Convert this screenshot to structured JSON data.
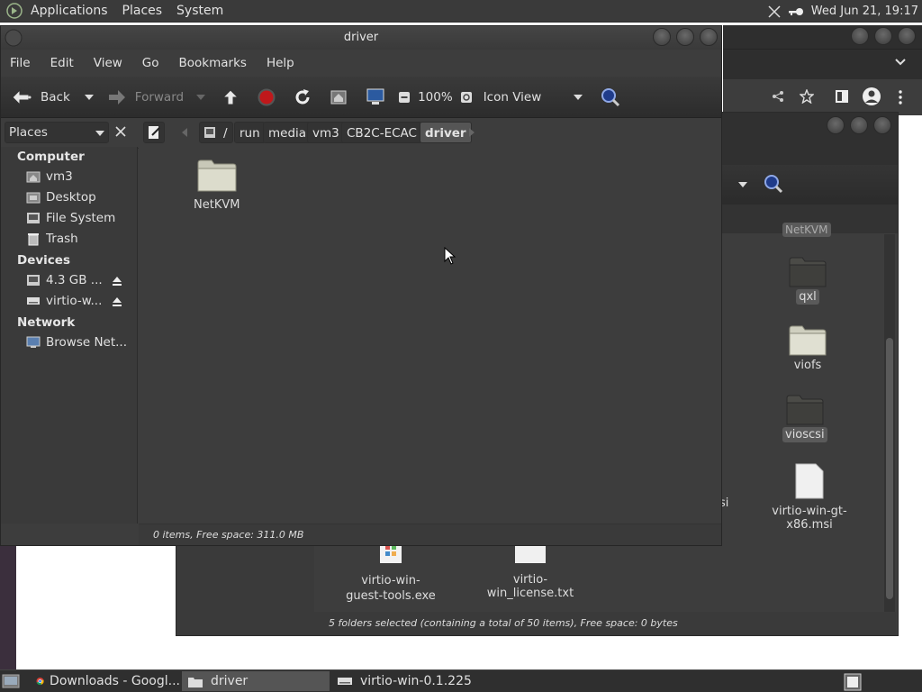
{
  "top_panel": {
    "menus": [
      "Applications",
      "Places",
      "System"
    ],
    "clock": "Wed Jun 21, 19:17"
  },
  "front_window": {
    "title": "driver",
    "menubar": [
      "File",
      "Edit",
      "View",
      "Go",
      "Bookmarks",
      "Help"
    ],
    "toolbar": {
      "back": "Back",
      "forward": "Forward",
      "zoom": "100%",
      "view_mode": "Icon View"
    },
    "sidebar_selector": "Places",
    "breadcrumbs": [
      "/",
      "run",
      "media",
      "vm3",
      "CB2C-ECAC",
      "driver"
    ],
    "sidebar": {
      "computer_heading": "Computer",
      "computer_items": [
        "vm3",
        "Desktop",
        "File System",
        "Trash"
      ],
      "devices_heading": "Devices",
      "device_items": [
        "4.3 GB ...",
        "virtio-w..."
      ],
      "network_heading": "Network",
      "network_items": [
        "Browse Net..."
      ]
    },
    "files": [
      {
        "name": "NetKVM",
        "icon": "folder-icon"
      }
    ],
    "status": "0 items, Free space: 311.0 MB"
  },
  "back_window": {
    "files": [
      {
        "name": "NetKVM",
        "icon": "folder-icon"
      },
      {
        "name": "qxl",
        "icon": "folder-icon"
      },
      {
        "name": "viofs",
        "icon": "folder-icon"
      },
      {
        "name": "vioscsi",
        "icon": "folder-icon"
      },
      {
        "name": "virtio-win-gt-x86.msi",
        "icon": "document-icon"
      },
      {
        "name": "virtio-win-guest-tools.exe",
        "icon": "installer-icon"
      },
      {
        "name": "virtio-win_license.txt",
        "icon": "text-file-icon"
      }
    ],
    "partial_label": "si",
    "status": "5 folders selected (containing a total of 50 items), Free space: 0 bytes"
  },
  "taskbar": {
    "tasks": [
      "Downloads - Googl...",
      "driver",
      "virtio-win-0.1.225"
    ]
  },
  "colors": {
    "panel": "#3a3a3a",
    "window_bg": "#3d3d3d",
    "folder": "#d8d8c8",
    "stop_red": "#c0181b",
    "search_blue": "#1f3b8a"
  }
}
